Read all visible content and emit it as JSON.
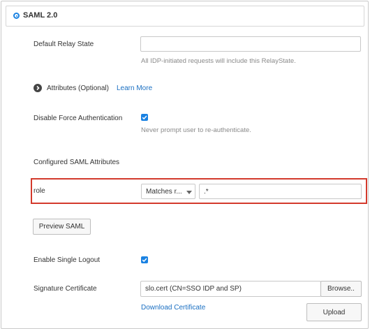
{
  "section": {
    "title": "SAML 2.0"
  },
  "relay": {
    "label": "Default Relay State",
    "value": "",
    "hint": "All IDP-initiated requests will include this RelayState."
  },
  "attributes": {
    "label": "Attributes (Optional)",
    "learn_more": "Learn More"
  },
  "force_auth": {
    "label": "Disable Force Authentication",
    "checked": true,
    "hint": "Never prompt user to re-authenticate."
  },
  "configured": {
    "label": "Configured SAML Attributes",
    "rows": [
      {
        "name": "role",
        "match_type": "Matches r...",
        "value": ".*"
      }
    ]
  },
  "preview": {
    "label": "Preview SAML"
  },
  "single_logout": {
    "label": "Enable Single Logout",
    "checked": true
  },
  "signature": {
    "label": "Signature Certificate",
    "value": "slo.cert (CN=SSO IDP and SP)",
    "browse": "Browse..",
    "download": "Download Certificate",
    "upload": "Upload"
  },
  "colors": {
    "accent": "#1a82e2",
    "link": "#1a6fc2",
    "highlight": "#d33a2c"
  }
}
